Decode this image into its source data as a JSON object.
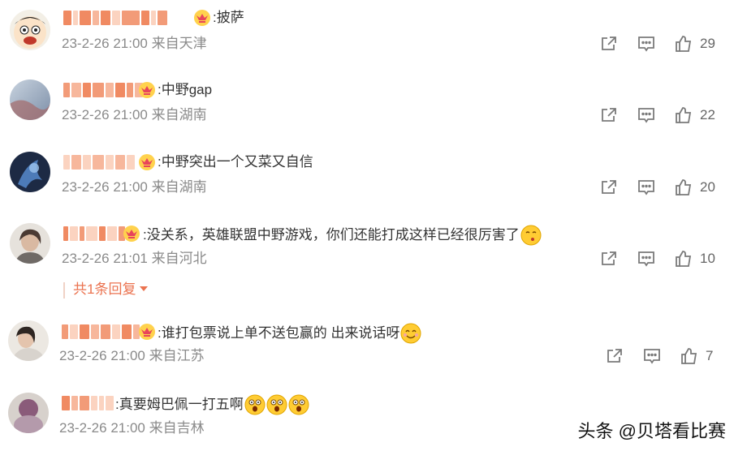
{
  "comments": [
    {
      "text": ":披萨",
      "time": "23-2-26 21:00",
      "location": "来自天津",
      "likes": "29"
    },
    {
      "text": ":中野gap",
      "time": "23-2-26 21:00",
      "location": "来自湖南",
      "likes": "22"
    },
    {
      "text": ":中野突出一个又菜又自信",
      "time": "23-2-26 21:00",
      "location": "来自湖南",
      "likes": "20"
    },
    {
      "text": ":没关系，英雄联盟中野游戏，你们还能打成这样已经很厉害了",
      "time": "23-2-26 21:01",
      "location": "来自河北",
      "likes": "10",
      "replies": "共1条回复"
    },
    {
      "text": ":谁打包票说上单不送包赢的 出来说话呀",
      "time": "23-2-26 21:00",
      "location": "来自江苏",
      "likes": "7"
    },
    {
      "text": ":真要姆巴佩一打五啊",
      "time": "23-2-26 21:00",
      "location": "来自吉林",
      "likes": ""
    }
  ],
  "watermark": "头条 @贝塔看比赛",
  "colors": {
    "accent": "#eb7350",
    "meta": "#8a8a8a",
    "icon": "#7a7a7a"
  },
  "icons": {
    "forward": "share-arrow-icon",
    "comment": "speech-bubble-icon",
    "like": "thumbs-up-icon",
    "vip": "crown-icon"
  }
}
